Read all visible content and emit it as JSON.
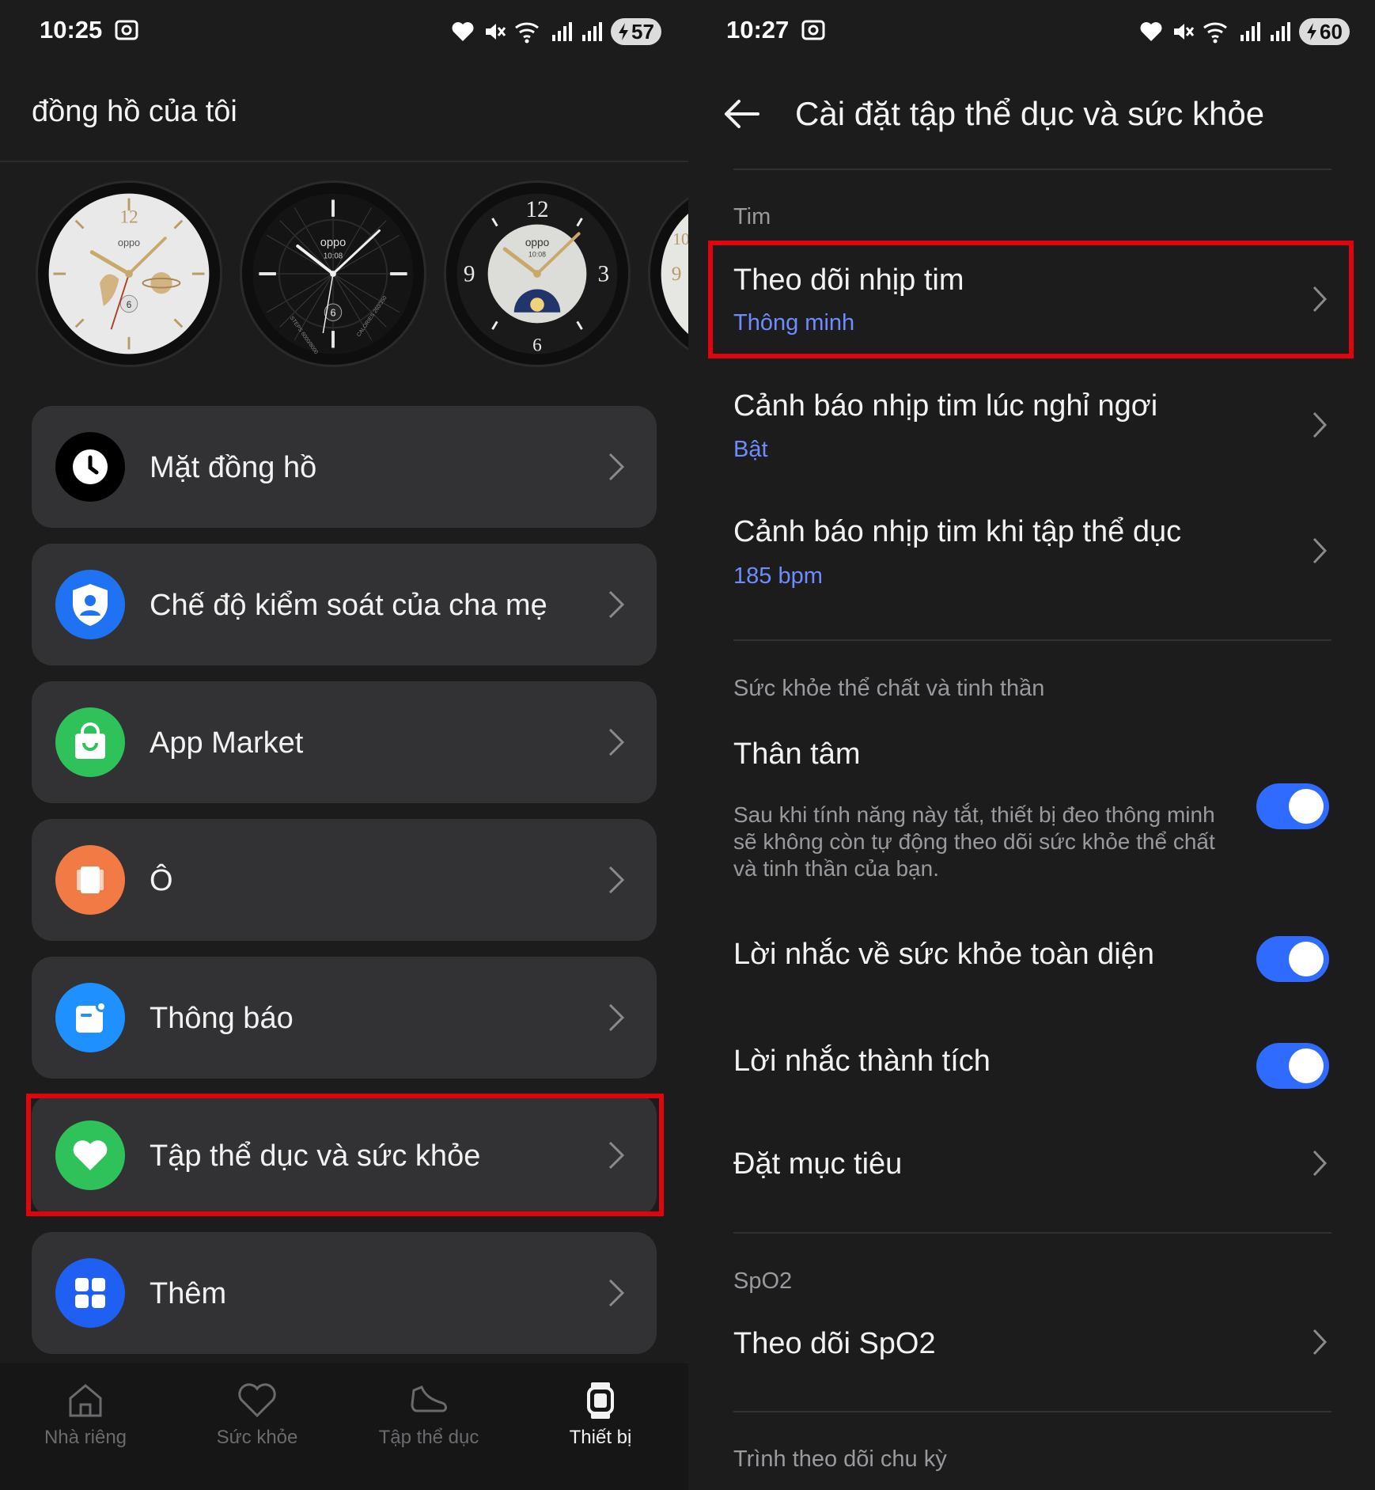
{
  "left": {
    "status": {
      "time": "10:25",
      "battery": "57"
    },
    "title": "đồng hồ của tôi",
    "menu": [
      {
        "label": "Mặt đồng hồ",
        "icon": "clock-icon",
        "color": "#000000"
      },
      {
        "label": "Chế độ kiểm soát của cha mẹ",
        "icon": "shield-user-icon",
        "color": "#1f73f2"
      },
      {
        "label": "App Market",
        "icon": "shopping-bag-icon",
        "color": "#2fc25b"
      },
      {
        "label": "Ô",
        "icon": "tile-icon",
        "color": "#f27a45"
      },
      {
        "label": "Thông báo",
        "icon": "notification-icon",
        "color": "#1e90ff"
      },
      {
        "label": "Tập thể dục và sức khỏe",
        "icon": "heart-icon",
        "color": "#2fc25b"
      },
      {
        "label": "Thêm",
        "icon": "grid-icon",
        "color": "#1f5ff2"
      }
    ],
    "nav": [
      {
        "label": "Nhà riêng",
        "icon": "home-icon"
      },
      {
        "label": "Sức khỏe",
        "icon": "heart-outline-icon"
      },
      {
        "label": "Tập thể dục",
        "icon": "shoe-icon"
      },
      {
        "label": "Thiết bị",
        "icon": "watch-icon",
        "active": true
      }
    ],
    "faces": {
      "face1": {
        "brand": "oppo",
        "twelve": "12",
        "six": "6"
      },
      "face2": {
        "brand": "oppo",
        "time": "10:08",
        "six": "6",
        "steps": "STEPS 6000/8000",
        "calories": "CALORIES 260/350"
      },
      "face3": {
        "brand": "oppo",
        "time": "10:08",
        "twelve": "12",
        "nine": "9",
        "three": "3",
        "six": "6"
      },
      "face4": {
        "ten": "10",
        "nine": "9"
      }
    }
  },
  "right": {
    "status": {
      "time": "10:27",
      "battery": "60"
    },
    "title": "Cài đặt tập thể dục và sức khỏe",
    "sections": {
      "heart": {
        "header": "Tim"
      },
      "wellbeing": {
        "header": "Sức khỏe thể chất và tinh thần"
      },
      "spo2": {
        "header": "SpO2"
      },
      "cycle": {
        "header": "Trình theo dõi chu kỳ"
      }
    },
    "settings": {
      "hr_monitor": {
        "title": "Theo dõi nhịp tim",
        "value": "Thông minh"
      },
      "resting_alert": {
        "title": "Cảnh báo nhịp tim lúc nghỉ ngơi",
        "value": "Bật"
      },
      "exercise_alert": {
        "title": "Cảnh báo nhịp tim khi tập thể dục",
        "value": "185 bpm"
      },
      "mind_body": {
        "title": "Thân tâm",
        "desc": "Sau khi tính năng này tắt, thiết bị đeo thông minh sẽ không còn tự động theo dõi sức khỏe thể chất và tinh thần của bạn.",
        "enabled": true
      },
      "health_reminder": {
        "title": "Lời nhắc về sức khỏe toàn diện",
        "enabled": true
      },
      "achievement_reminder": {
        "title": "Lời nhắc thành tích",
        "enabled": true
      },
      "goals": {
        "title": "Đặt mục tiêu"
      },
      "spo2_monitor": {
        "title": "Theo dõi SpO2"
      }
    }
  }
}
